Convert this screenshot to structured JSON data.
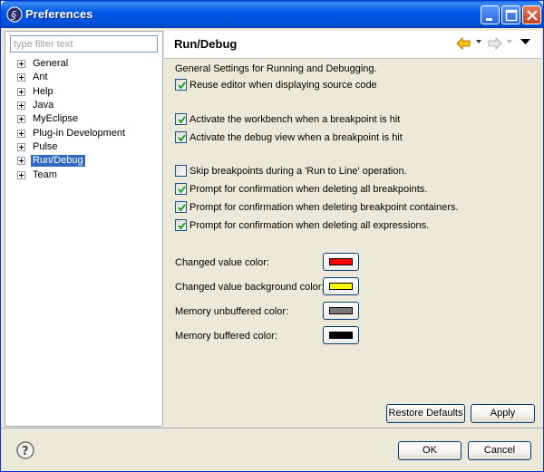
{
  "window": {
    "title": "Preferences"
  },
  "filter": {
    "placeholder": "type filter text",
    "value": ""
  },
  "tree": {
    "items": [
      {
        "label": "General"
      },
      {
        "label": "Ant"
      },
      {
        "label": "Help"
      },
      {
        "label": "Java"
      },
      {
        "label": "MyEclipse"
      },
      {
        "label": "Plug-in Development"
      },
      {
        "label": "Pulse"
      },
      {
        "label": "Run/Debug",
        "selected": true
      },
      {
        "label": "Team"
      }
    ]
  },
  "page": {
    "title": "Run/Debug",
    "intro": "General Settings for Running and Debugging.",
    "checkboxes": [
      {
        "label": "Reuse editor when displaying source code",
        "checked": true
      },
      {
        "label": "Activate the workbench when a breakpoint is hit",
        "checked": true
      },
      {
        "label": "Activate the debug view when a breakpoint is hit",
        "checked": true
      },
      {
        "label": "Skip breakpoints during a 'Run to Line' operation.",
        "checked": false
      },
      {
        "label": "Prompt for confirmation when deleting all breakpoints.",
        "checked": true
      },
      {
        "label": "Prompt for confirmation when deleting breakpoint containers.",
        "checked": true
      },
      {
        "label": "Prompt for confirmation when deleting all expressions.",
        "checked": true
      }
    ],
    "colors": [
      {
        "label": "Changed value color:",
        "value": "#ff0000"
      },
      {
        "label": "Changed value background color:",
        "value": "#ffff00"
      },
      {
        "label": "Memory unbuffered color:",
        "value": "#7a7a7a"
      },
      {
        "label": "Memory buffered color:",
        "value": "#000000"
      }
    ],
    "restore_defaults_label": "Restore Defaults",
    "apply_label": "Apply"
  },
  "footer": {
    "ok_label": "OK",
    "cancel_label": "Cancel"
  },
  "theme": {
    "titlebar": "#0058e6",
    "selection": "#316ac5",
    "dialog_bg": "#ece9d8"
  },
  "icons": {
    "app": "eclipse-icon",
    "minimize": "minimize-icon",
    "maximize": "maximize-icon",
    "close": "close-icon",
    "back": "back-arrow-icon",
    "forward": "forward-arrow-icon",
    "view_menu": "view-menu-icon",
    "help": "help-icon"
  }
}
